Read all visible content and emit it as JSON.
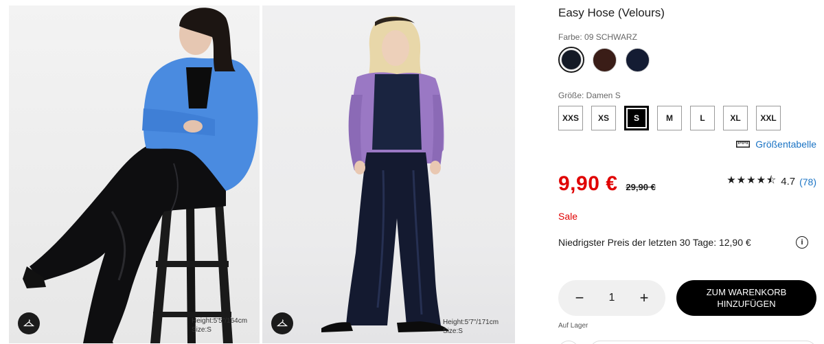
{
  "gallery": {
    "photo1": {
      "model_info_line1": "Height:5'5\"/164cm",
      "model_info_line2": "Size:S"
    },
    "photo2": {
      "model_info_line1": "Height:5'7\"/171cm",
      "model_info_line2": "Size:S"
    },
    "hanger_icon": "hanger-icon"
  },
  "product": {
    "title": "Easy Hose (Velours)",
    "color_label": "Farbe: 09 SCHWARZ",
    "colors": [
      {
        "name": "09 SCHWARZ",
        "hex": "#141a26",
        "selected": true
      },
      {
        "name": "brown",
        "hex": "#3a1d17",
        "selected": false
      },
      {
        "name": "navy",
        "hex": "#141c33",
        "selected": false
      }
    ],
    "size_label": "Größe: Damen S",
    "sizes": [
      "XXS",
      "XS",
      "S",
      "M",
      "L",
      "XL",
      "XXL"
    ],
    "selected_size": "S",
    "size_chart_label": "Größentabelle",
    "size_chart_icon": "ruler-icon",
    "price": "9,90 €",
    "old_price": "29,90 €",
    "rating_value": "4.7",
    "rating_count": "(78)",
    "stars": "★★★★⯪",
    "sale_label": "Sale",
    "lowest_price": "Niedrigster Preis der letzten 30 Tage: 12,90 €",
    "info_icon": "i",
    "quantity": "1",
    "minus_symbol": "−",
    "plus_symbol": "+",
    "add_to_cart_line1": "ZUM WARENKORB",
    "add_to_cart_line2": "HINZUFÜGEN",
    "stock_label": "Auf Lager"
  },
  "colors": {
    "accent_price": "#e00000",
    "link": "#1a73c4",
    "button": "#000000"
  }
}
